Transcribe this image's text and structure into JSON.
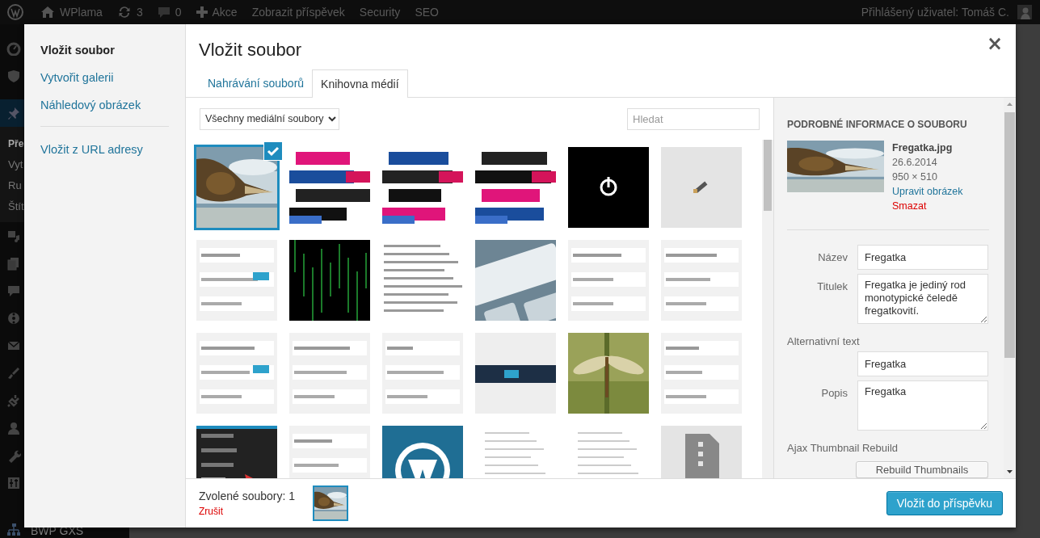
{
  "admin_bar": {
    "site": "WPlama",
    "updates": "3",
    "comments": "0",
    "new": "Akce",
    "links": [
      "Zobrazit příspěvek",
      "Security",
      "SEO"
    ],
    "account": "Přihlášený uživatel: Tomáš C."
  },
  "admin_menu": {
    "items": [
      {
        "selected": false
      },
      {
        "selected": false
      },
      {
        "selected": true,
        "submenu": [
          {
            "label": "Pře",
            "selected": true
          },
          {
            "label": "Vyt",
            "selected": false
          },
          {
            "label": "Ru",
            "selected": false
          },
          {
            "label": "Štít",
            "selected": false
          }
        ]
      },
      {
        "selected": false
      },
      {
        "selected": false
      },
      {
        "selected": false
      },
      {
        "selected": false
      },
      {
        "selected": false
      },
      {
        "selected": false
      },
      {
        "selected": false
      },
      {
        "selected": false
      },
      {
        "selected": false
      },
      {
        "selected": false
      },
      {
        "selected": false,
        "label": "BWP GXS"
      }
    ]
  },
  "modal": {
    "title": "Vložit soubor",
    "close": "×",
    "menu": [
      {
        "label": "Vložit soubor",
        "selected": true,
        "separator_before": false
      },
      {
        "label": "Vytvořit galerii",
        "selected": false,
        "separator_before": false
      },
      {
        "label": "Náhledový obrázek",
        "selected": false,
        "separator_before": false
      },
      {
        "label": "Vložit z URL adresy",
        "selected": false,
        "separator_before": true
      }
    ],
    "tabs": [
      {
        "label": "Nahrávání souborů",
        "selected": false
      },
      {
        "label": "Knihovna médií",
        "selected": true
      }
    ],
    "filter": "Všechny mediální soubory",
    "search": {
      "placeholder": "Hledat"
    },
    "items": [
      {
        "selected": true
      },
      {
        "selected": false
      },
      {
        "selected": false
      },
      {
        "selected": false
      },
      {
        "selected": false
      },
      {
        "selected": false
      },
      {
        "selected": false
      },
      {
        "selected": false
      },
      {
        "selected": false
      },
      {
        "selected": false
      },
      {
        "selected": false
      },
      {
        "selected": false
      },
      {
        "selected": false
      },
      {
        "selected": false
      },
      {
        "selected": false
      },
      {
        "selected": false
      },
      {
        "selected": false
      },
      {
        "selected": false
      },
      {
        "selected": false
      },
      {
        "selected": false
      },
      {
        "selected": false
      },
      {
        "selected": false
      },
      {
        "selected": false
      },
      {
        "selected": false
      }
    ],
    "details": {
      "heading": "PODROBNÉ INFORMACE O SOUBORU",
      "filename": "Fregatka.jpg",
      "date": "26.6.2014",
      "dimensions": "950 × 510",
      "edit_link": "Upravit obrázek",
      "delete_link": "Smazat",
      "fields": [
        {
          "label": "Název",
          "value": "Fregatka",
          "kind": "input"
        },
        {
          "label": "Titulek",
          "value": "Fregatka je jediný rod monotypické čeledě fregatkovití.",
          "kind": "textarea"
        },
        {
          "label": "Alternativní text",
          "value": "Fregatka",
          "kind": "input_below"
        },
        {
          "label": "Popis",
          "value": "Fregatka",
          "kind": "textarea"
        }
      ],
      "plugin_label": "Ajax Thumbnail Rebuild",
      "plugin_button": "Rebuild Thumbnails"
    },
    "selection": {
      "count_label": "Zvolené soubory: 1",
      "clear": "Zrušit"
    },
    "insert_button": "Vložit do příspěvku"
  }
}
